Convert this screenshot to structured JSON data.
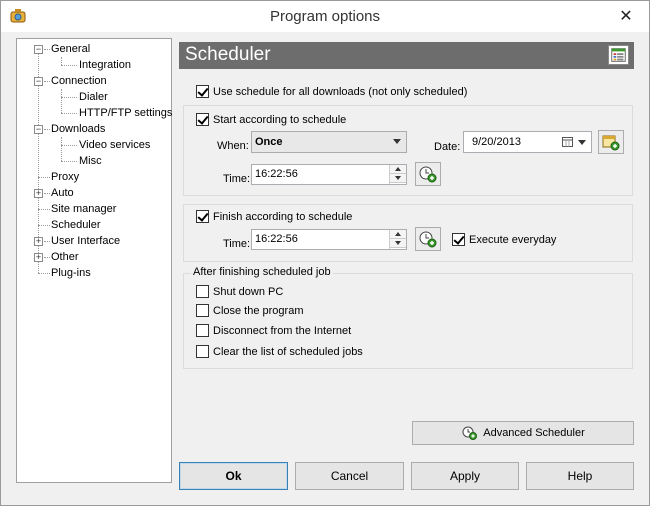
{
  "window": {
    "title": "Program options",
    "close_glyph": "✕"
  },
  "tree": {
    "items": [
      {
        "label": "General"
      },
      {
        "label": "Integration"
      },
      {
        "label": "Connection"
      },
      {
        "label": "Dialer"
      },
      {
        "label": "HTTP/FTP settings"
      },
      {
        "label": "Downloads"
      },
      {
        "label": "Video services"
      },
      {
        "label": "Misc"
      },
      {
        "label": "Proxy"
      },
      {
        "label": "Auto"
      },
      {
        "label": "Site manager"
      },
      {
        "label": "Scheduler"
      },
      {
        "label": "User Interface"
      },
      {
        "label": "Other"
      },
      {
        "label": "Plug-ins"
      }
    ],
    "selected": "Scheduler"
  },
  "panel": {
    "title": "Scheduler",
    "use_schedule_all": {
      "label": "Use schedule for all downloads (not only scheduled)",
      "checked": true
    },
    "start": {
      "label": "Start according to schedule",
      "checked": true,
      "when_label": "When:",
      "when_value": "Once",
      "date_label": "Date:",
      "date_value": "9/20/2013",
      "time_label": "Time:",
      "time_value": "16:22:56"
    },
    "finish": {
      "label": "Finish according to schedule",
      "checked": true,
      "time_label": "Time:",
      "time_value": "16:22:56",
      "everyday_label": "Execute everyday",
      "everyday_checked": true
    },
    "after": {
      "title": "After finishing scheduled job",
      "options": [
        {
          "label": "Shut down PC",
          "checked": false
        },
        {
          "label": "Close the program",
          "checked": false
        },
        {
          "label": "Disconnect from the Internet",
          "checked": false
        },
        {
          "label": "Clear the list of scheduled jobs",
          "checked": false
        }
      ]
    },
    "advanced_label": "Advanced Scheduler"
  },
  "buttons": {
    "ok": "Ok",
    "cancel": "Cancel",
    "apply": "Apply",
    "help": "Help"
  },
  "colors": {
    "header": "#6d6d6d",
    "accent_green": "#3a9a2c"
  }
}
